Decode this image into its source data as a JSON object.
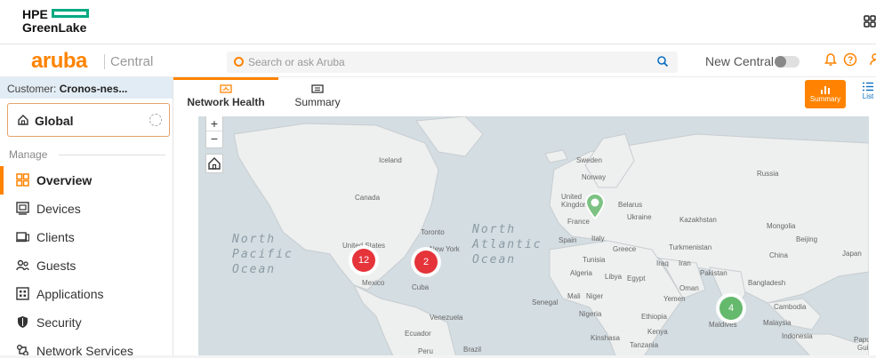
{
  "hpe": {
    "line1": "HPE",
    "line2": "GreenLake"
  },
  "header": {
    "brand": "aruba",
    "product": "Central",
    "search_placeholder": "Search or ask Aruba",
    "new_central_label": "New Central"
  },
  "sidebar": {
    "customer_prefix": "Customer: ",
    "customer_name": "Cronos-nes...",
    "scope": "Global",
    "section": "Manage",
    "items": [
      {
        "label": "Overview",
        "icon": "grid-icon"
      },
      {
        "label": "Devices",
        "icon": "devices-icon"
      },
      {
        "label": "Clients",
        "icon": "clients-icon"
      },
      {
        "label": "Guests",
        "icon": "guests-icon"
      },
      {
        "label": "Applications",
        "icon": "applications-icon"
      },
      {
        "label": "Security",
        "icon": "shield-icon"
      },
      {
        "label": "Network Services",
        "icon": "network-services-icon"
      }
    ]
  },
  "tabs": [
    {
      "label": "Network Health"
    },
    {
      "label": "Summary"
    }
  ],
  "view_toggle": {
    "summary": "Summary",
    "list": "List"
  },
  "map": {
    "zoom_in": "+",
    "zoom_out": "−",
    "oceans": {
      "north_pacific": "North\nPacific\nOcean",
      "north_atlantic": "North\nAtlantic\nOcean"
    },
    "places": {
      "iceland": "Iceland",
      "sweden": "Sweden",
      "norway": "Norway",
      "russia": "Russia",
      "canada": "Canada",
      "uk": "United\nKingdom",
      "belarus": "Belarus",
      "ukraine": "Ukraine",
      "france": "France",
      "kazakhstan": "Kazakhstan",
      "mongolia": "Mongolia",
      "toronto": "Toronto",
      "united_states": "United States",
      "new_york": "New York",
      "spain": "Spain",
      "italy": "Italy",
      "greece": "Greece",
      "turkmenistan": "Turkmenistan",
      "beijing": "Beijing",
      "china": "China",
      "japan": "Japan",
      "tunisia": "Tunisia",
      "iraq": "Iraq",
      "iran": "Iran",
      "pakistan": "Pakistan",
      "algeria": "Algeria",
      "libya": "Libya",
      "egypt": "Egypt",
      "mexico": "Mexico",
      "cuba": "Cuba",
      "oman": "Oman",
      "bangladesh": "Bangladesh",
      "mali": "Mali",
      "niger": "Niger",
      "yemen": "Yemen",
      "senegal": "Senegal",
      "nigeria": "Nigeria",
      "ethiopia": "Ethiopia",
      "cambodia": "Cambodia",
      "venezuela": "Venezuela",
      "maldives": "Maldives",
      "malaysia": "Malaysia",
      "kenya": "Kenya",
      "ecuador": "Ecuador",
      "kinshasa": "Kinshasa",
      "indonesia": "Indonesia",
      "tanzania": "Tanzania",
      "papua": "Papua",
      "guinea": "Guin",
      "peru": "Peru",
      "brazil": "Brazil"
    },
    "clusters": [
      {
        "count": "12",
        "status": "red"
      },
      {
        "count": "2",
        "status": "red"
      },
      {
        "count": "4",
        "status": "green"
      }
    ]
  },
  "colors": {
    "accent": "#ff8300",
    "hpe_green": "#01a982",
    "alert_red": "#e5343a",
    "ok_green": "#65b96d"
  }
}
